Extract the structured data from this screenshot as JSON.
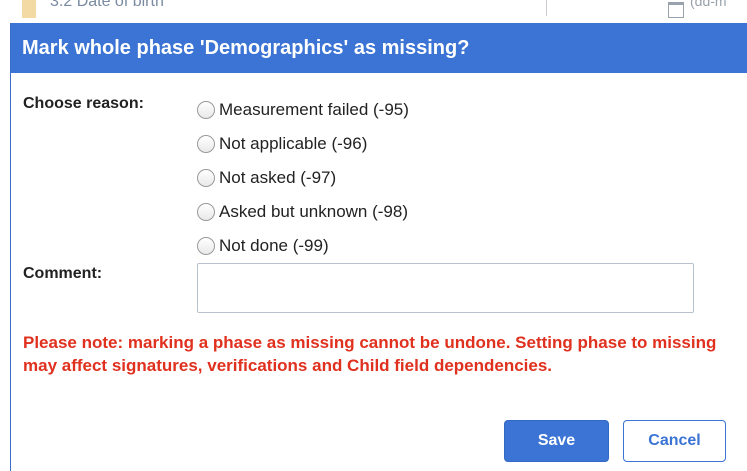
{
  "background": {
    "row_label": "3.2  Date of birth",
    "hint": "(dd-m"
  },
  "dialog": {
    "title": "Mark whole phase 'Demographics' as missing?",
    "reason_label": "Choose reason:",
    "reasons": [
      "Measurement failed (-95)",
      "Not applicable (-96)",
      "Not asked (-97)",
      "Asked but unknown (-98)",
      "Not done (-99)"
    ],
    "comment_label": "Comment:",
    "comment_value": "",
    "warning": "Please note: marking a phase as missing cannot be undone. Setting phase to missing may affect signatures, verifications and Child field dependencies.",
    "save_label": "Save",
    "cancel_label": "Cancel"
  },
  "colors": {
    "header_bg": "#3b74d4",
    "warning": "#e0301e",
    "primary": "#3b74d4"
  },
  "icons": {
    "calendar": "calendar-icon"
  }
}
